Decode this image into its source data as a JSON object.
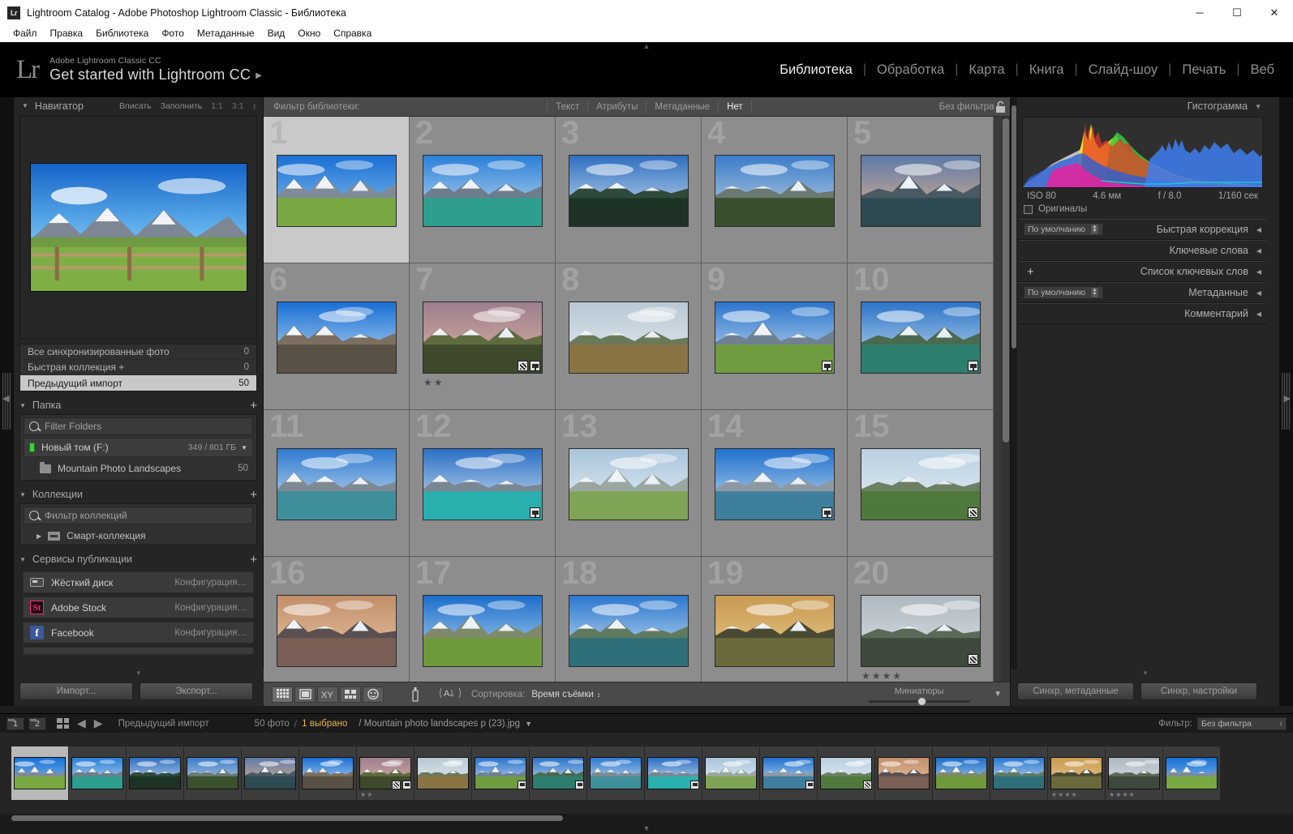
{
  "window": {
    "title": "Lightroom Catalog - Adobe Photoshop Lightroom Classic - Библиотека",
    "app_icon": "Lr",
    "minimize": "─",
    "maximize": "☐",
    "close": "✕"
  },
  "menu": [
    "Файл",
    "Правка",
    "Библиотека",
    "Фото",
    "Метаданные",
    "Вид",
    "Окно",
    "Справка"
  ],
  "identity": {
    "logo": "Lr",
    "subtitle": "Adobe Lightroom Classic CC",
    "title": "Get started with Lightroom CC",
    "arrow": "▶"
  },
  "modules": [
    {
      "label": "Библиотека",
      "active": true
    },
    {
      "label": "Обработка",
      "active": false
    },
    {
      "label": "Карта",
      "active": false
    },
    {
      "label": "Книга",
      "active": false
    },
    {
      "label": "Слайд-шоу",
      "active": false
    },
    {
      "label": "Печать",
      "active": false
    },
    {
      "label": "Веб",
      "active": false
    }
  ],
  "navigator": {
    "title": "Навигатор",
    "options": [
      "Вписать",
      "Заполнить",
      "1:1",
      "3:1"
    ],
    "stepper": "↕"
  },
  "catalog": {
    "rows": [
      {
        "label": "Все синхронизированные фото",
        "count": "0",
        "selected": false
      },
      {
        "label": "Быстрая коллекция  +",
        "count": "0",
        "selected": false
      },
      {
        "label": "Предыдущий импорт",
        "count": "50",
        "selected": true
      }
    ]
  },
  "folders": {
    "title": "Папка",
    "plus": "+",
    "filter_placeholder": "Filter Folders",
    "volume": {
      "name": "Новый том (F:)",
      "size": "349 / 801 ГБ",
      "caret": "▼"
    },
    "items": [
      {
        "label": "Mountain Photo Landscapes",
        "count": "50"
      }
    ]
  },
  "collections": {
    "title": "Коллекции",
    "plus": "+",
    "filter_placeholder": "Фильтр коллекций",
    "items": [
      {
        "label": "Смарт-коллекция",
        "arrow": "▶"
      }
    ]
  },
  "publish": {
    "title": "Сервисы публикации",
    "plus": "+",
    "services": [
      {
        "name": "Жёсткий диск",
        "action": "Конфигурация…",
        "icon": "harddrive-icon"
      },
      {
        "name": "Adobe Stock",
        "action": "Конфигурация…",
        "icon": "adobe-stock-icon",
        "badge": "St"
      },
      {
        "name": "Facebook",
        "action": "Конфигурация…",
        "icon": "facebook-icon",
        "badge": "f"
      }
    ]
  },
  "left_buttons": {
    "import": "Импорт...",
    "export": "Экспорт..."
  },
  "library_filter": {
    "label": "Фильтр библиотеки:",
    "tabs": [
      {
        "label": "Текст",
        "active": false
      },
      {
        "label": "Атрибуты",
        "active": false
      },
      {
        "label": "Метаданные",
        "active": false
      },
      {
        "label": "Нет",
        "active": true
      }
    ],
    "preset": "Без фильтра",
    "stepper": "↕",
    "lock_icon": "lock-icon"
  },
  "grid": {
    "cells": [
      {
        "index": "1",
        "selected": true,
        "badges": [],
        "stars": ""
      },
      {
        "index": "2",
        "selected": false,
        "badges": [],
        "stars": ""
      },
      {
        "index": "3",
        "selected": false,
        "badges": [],
        "stars": ""
      },
      {
        "index": "4",
        "selected": false,
        "badges": [],
        "stars": ""
      },
      {
        "index": "5",
        "selected": false,
        "badges": [],
        "stars": ""
      },
      {
        "index": "6",
        "selected": false,
        "badges": [],
        "stars": ""
      },
      {
        "index": "7",
        "selected": false,
        "badges": [
          "crop",
          "meta"
        ],
        "stars": "★★"
      },
      {
        "index": "8",
        "selected": false,
        "badges": [],
        "stars": ""
      },
      {
        "index": "9",
        "selected": false,
        "badges": [
          "meta"
        ],
        "stars": ""
      },
      {
        "index": "10",
        "selected": false,
        "badges": [
          "meta"
        ],
        "stars": ""
      },
      {
        "index": "11",
        "selected": false,
        "badges": [],
        "stars": ""
      },
      {
        "index": "12",
        "selected": false,
        "badges": [
          "meta"
        ],
        "stars": ""
      },
      {
        "index": "13",
        "selected": false,
        "badges": [],
        "stars": ""
      },
      {
        "index": "14",
        "selected": false,
        "badges": [
          "meta"
        ],
        "stars": ""
      },
      {
        "index": "15",
        "selected": false,
        "badges": [
          "crop"
        ],
        "stars": ""
      },
      {
        "index": "16",
        "selected": false,
        "badges": [],
        "stars": ""
      },
      {
        "index": "17",
        "selected": false,
        "badges": [],
        "stars": ""
      },
      {
        "index": "18",
        "selected": false,
        "badges": [],
        "stars": ""
      },
      {
        "index": "19",
        "selected": false,
        "badges": [],
        "stars": ""
      },
      {
        "index": "20",
        "selected": false,
        "badges": [
          "crop"
        ],
        "stars": "★★★★"
      }
    ]
  },
  "toolbar": {
    "view_buttons": [
      "grid-view-icon",
      "loupe-view-icon",
      "compare-view-icon",
      "survey-view-icon",
      "people-view-icon"
    ],
    "spray_icon": "spray-can-icon",
    "sort_icon": "sort-az-icon",
    "sort_label": "Сортировка:",
    "sort_value": "Время съёмки",
    "sort_caret": "↕",
    "thumbnails_label": "Миниатюры",
    "caret": "▼"
  },
  "histogram": {
    "title": "Гистограмма",
    "iso": "ISO 80",
    "focal": "4.6 мм",
    "aperture": "f / 8.0",
    "shutter": "1/160 сек",
    "originals": "Оригиналы"
  },
  "right_sections": [
    {
      "title": "Быстрая коррекция",
      "preset": "По умолчанию",
      "has_preset": true,
      "has_plus": false
    },
    {
      "title": "Ключевые слова",
      "preset": "",
      "has_preset": false,
      "has_plus": false
    },
    {
      "title": "Список ключевых слов",
      "preset": "",
      "has_preset": false,
      "has_plus": true
    },
    {
      "title": "Метаданные",
      "preset": "По умолчанию",
      "has_preset": true,
      "has_plus": false
    },
    {
      "title": "Комментарий",
      "preset": "",
      "has_preset": false,
      "has_plus": false
    }
  ],
  "right_buttons": {
    "sync_metadata": "Синхр, метаданные",
    "sync_settings": "Синхр, настройки"
  },
  "filmstrip_bar": {
    "screen1": "1",
    "screen2": "2",
    "grid_icon": "grid-icon",
    "prev_arrow": "◀",
    "next_arrow": "▶",
    "source": "Предыдущий импорт",
    "photo_count": "50 фото",
    "selected_count": "1 выбрано",
    "filename": "/ Mountain photo landscapes p (23).jpg",
    "file_caret": "▼",
    "filter_label": "Фильтр:",
    "filter_value": "Без фильтра",
    "filter_stepper": "↕"
  },
  "filmstrip": {
    "cells": [
      {
        "selected": true,
        "badges": [],
        "stars": ""
      },
      {
        "selected": false,
        "badges": [],
        "stars": ""
      },
      {
        "selected": false,
        "badges": [],
        "stars": ""
      },
      {
        "selected": false,
        "badges": [],
        "stars": ""
      },
      {
        "selected": false,
        "badges": [],
        "stars": ""
      },
      {
        "selected": false,
        "badges": [],
        "stars": ""
      },
      {
        "selected": false,
        "badges": [
          "crop",
          "meta"
        ],
        "stars": "★★"
      },
      {
        "selected": false,
        "badges": [],
        "stars": ""
      },
      {
        "selected": false,
        "badges": [
          "meta"
        ],
        "stars": ""
      },
      {
        "selected": false,
        "badges": [
          "meta"
        ],
        "stars": ""
      },
      {
        "selected": false,
        "badges": [],
        "stars": ""
      },
      {
        "selected": false,
        "badges": [
          "meta"
        ],
        "stars": ""
      },
      {
        "selected": false,
        "badges": [],
        "stars": ""
      },
      {
        "selected": false,
        "badges": [
          "meta"
        ],
        "stars": ""
      },
      {
        "selected": false,
        "badges": [
          "crop"
        ],
        "stars": ""
      },
      {
        "selected": false,
        "badges": [],
        "stars": ""
      },
      {
        "selected": false,
        "badges": [],
        "stars": ""
      },
      {
        "selected": false,
        "badges": [],
        "stars": ""
      },
      {
        "selected": false,
        "badges": [],
        "stars": "★★★★"
      },
      {
        "selected": false,
        "badges": [],
        "stars": "★★★★"
      },
      {
        "selected": false,
        "badges": [],
        "stars": ""
      }
    ]
  },
  "colors": {
    "accent_gold": "#e8b44a",
    "panel_bg": "#252525",
    "grid_bg": "#3a3a3a",
    "cell_bg": "#8d8d8d",
    "cell_selected": "#c9c9c9",
    "stock_pink": "#ff2d6f",
    "facebook_blue": "#3b5998",
    "volume_green": "#39d13b"
  }
}
